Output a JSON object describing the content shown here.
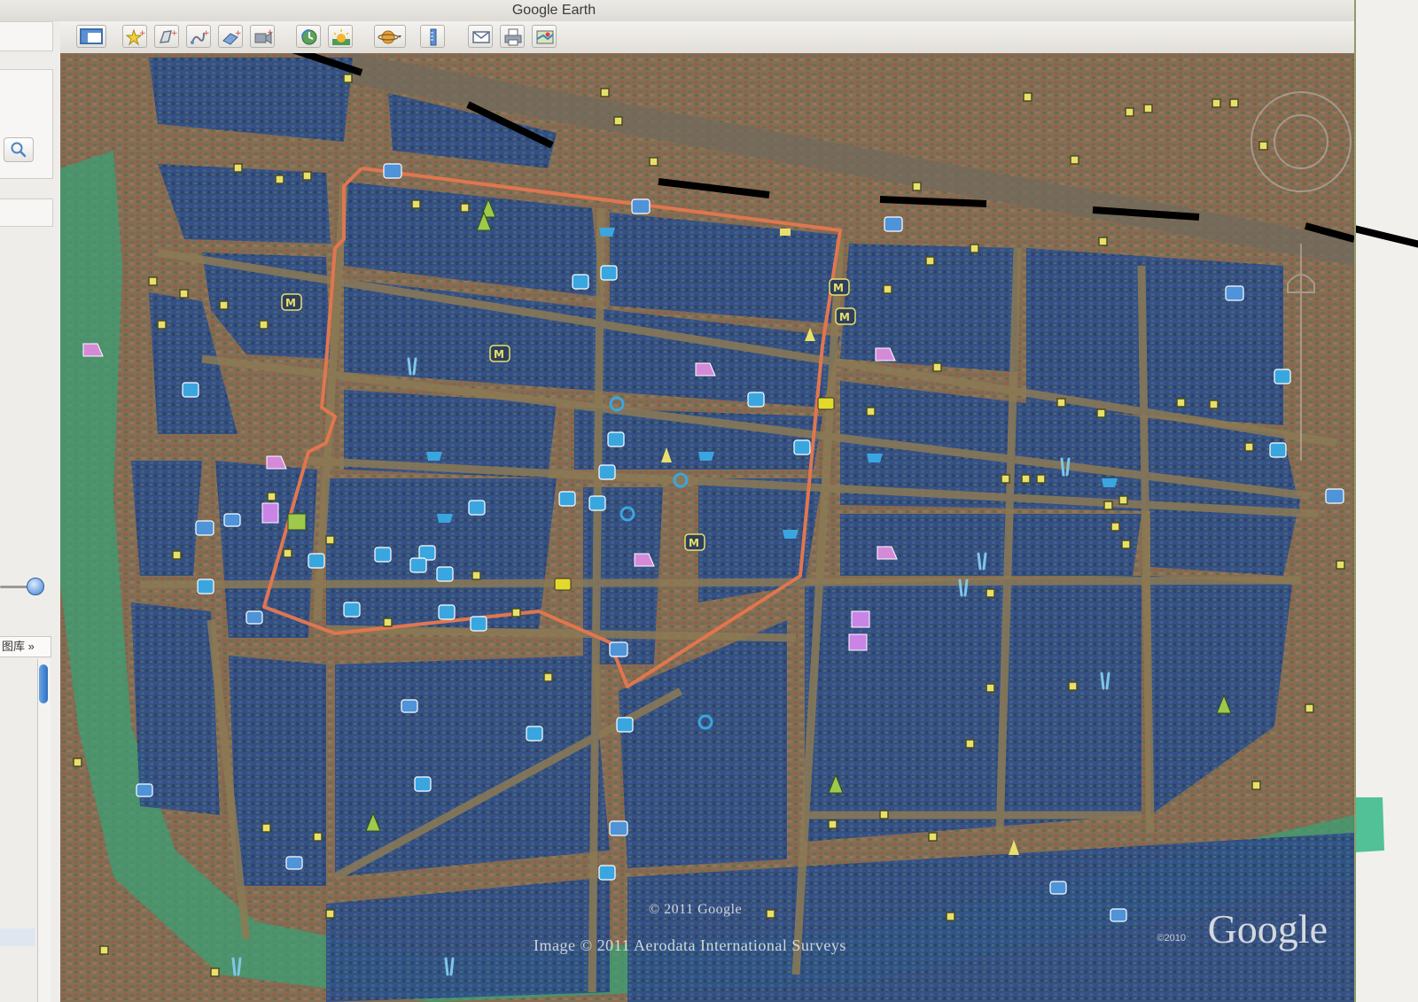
{
  "window": {
    "title": "Google Earth"
  },
  "toolbar": {
    "buttons": [
      {
        "name": "sidebar-toggle-button",
        "icon": "sidebar-icon"
      },
      {
        "name": "add-placemark-button",
        "icon": "placemark-icon"
      },
      {
        "name": "add-polygon-button",
        "icon": "polygon-icon"
      },
      {
        "name": "add-path-button",
        "icon": "path-icon"
      },
      {
        "name": "add-image-overlay-button",
        "icon": "image-overlay-icon"
      },
      {
        "name": "record-tour-button",
        "icon": "record-tour-icon"
      },
      {
        "name": "historical-imagery-button",
        "icon": "historical-imagery-icon"
      },
      {
        "name": "sunlight-button",
        "icon": "sunlight-icon"
      },
      {
        "name": "switch-planet-button",
        "icon": "planet-icon"
      },
      {
        "name": "ruler-button",
        "icon": "ruler-icon"
      },
      {
        "name": "email-button",
        "icon": "email-icon"
      },
      {
        "name": "print-button",
        "icon": "print-icon"
      },
      {
        "name": "view-in-maps-button",
        "icon": "maps-icon"
      }
    ]
  },
  "sidebar": {
    "gallery_label": "图库 »",
    "search_icon": "search-icon"
  },
  "map": {
    "copyright": "© 2011 Google",
    "imagery_credit": "Image © 2011 Aerodata International Surveys",
    "logo_year": "©2010",
    "logo_text": "Google",
    "colors": {
      "boundary": "#e0764f",
      "canal": "#2fa77a",
      "block_overlay": "#2d4f8c",
      "street": "#8c7a55"
    }
  }
}
